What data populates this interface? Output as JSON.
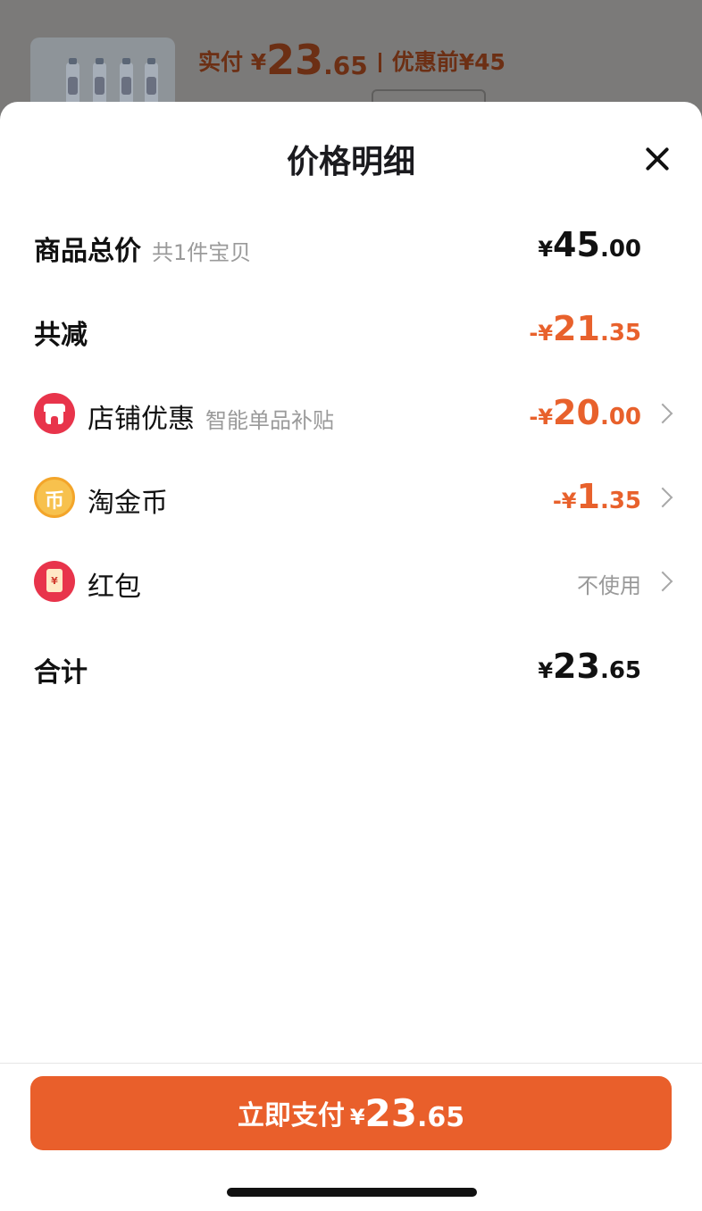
{
  "background": {
    "paid_label": "实付 ¥",
    "paid_int": "23",
    "paid_dec": ".65",
    "original_label": "优惠前¥45"
  },
  "sheet": {
    "title": "价格明细"
  },
  "rows": {
    "total": {
      "label": "商品总价",
      "sub": "共1件宝贝",
      "cur": "¥",
      "int": "45",
      "dec": ".00"
    },
    "reduce": {
      "label": "共减",
      "cur": "-¥",
      "int": "21",
      "dec": ".35"
    },
    "shop": {
      "label": "店铺优惠",
      "sub": "智能单品补贴",
      "cur": "-¥",
      "int": "20",
      "dec": ".00"
    },
    "coin": {
      "label": "淘金币",
      "icon_text": "币",
      "cur": "-¥",
      "int": "1",
      "dec": ".35"
    },
    "hongbao": {
      "label": "红包",
      "icon_text": "¥",
      "value": "不使用"
    },
    "sum": {
      "label": "合计",
      "cur": "¥",
      "int": "23",
      "dec": ".65"
    }
  },
  "pay_button": {
    "label": "立即支付",
    "cur": "¥",
    "int": "23",
    "dec": ".65"
  },
  "colors": {
    "accent": "#e95f2b",
    "discount": "#e8612c",
    "shop_icon": "#e8344b",
    "coin_icon": "#f7c14d"
  },
  "icons": [
    "close-icon",
    "shop-icon",
    "coin-icon",
    "hongbao-icon",
    "chevron-right-icon"
  ]
}
